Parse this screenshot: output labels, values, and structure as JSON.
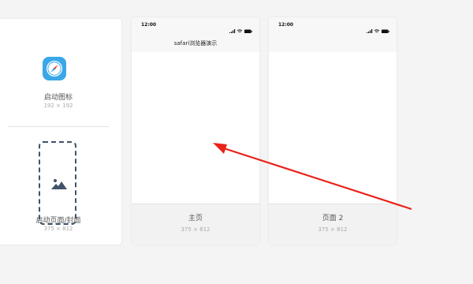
{
  "assets": {
    "launch_icon_label": "启动图标",
    "launch_icon_size": "192 × 192",
    "splash_label": "启动页面/封面",
    "splash_size": "375 × 812"
  },
  "pages": [
    {
      "status_time": "12:00",
      "nav_title": "safari浏览器演示",
      "name": "主页",
      "size": "375 × 812"
    },
    {
      "status_time": "12:00",
      "nav_title": "",
      "name": "页面 2",
      "size": "375 × 812"
    }
  ],
  "colors": {
    "accent_icon": "#3aa7e8",
    "annotation_arrow": "#e8231a",
    "dashed_border": "#40536a"
  },
  "icons": [
    "safari-compass-icon",
    "image-placeholder-icon",
    "signal-icon",
    "wifi-icon",
    "battery-icon"
  ]
}
